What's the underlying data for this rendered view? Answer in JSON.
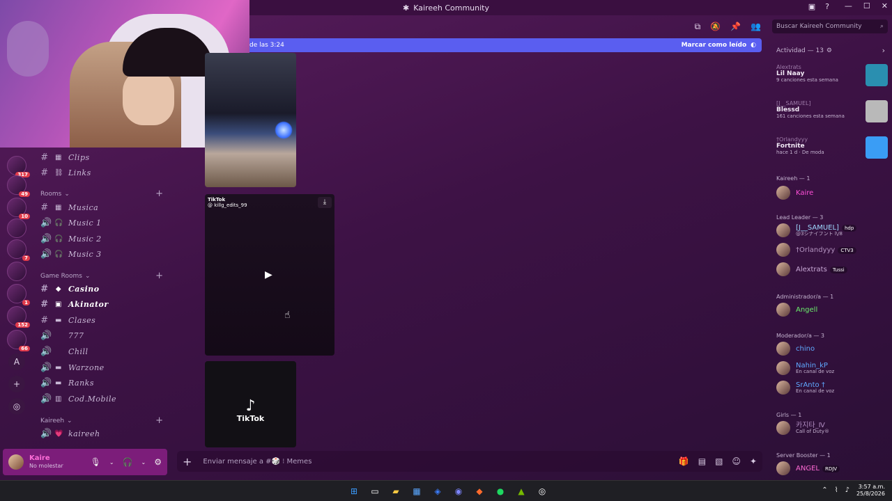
{
  "window": {
    "title": "Kaireeh Community",
    "min": "—",
    "max": "☐",
    "close": "✕"
  },
  "titlebar_icons": {
    "inbox": "▣",
    "help": "?"
  },
  "chat_header": {
    "icons": [
      "threads-icon",
      "mute-icon",
      "pin-icon",
      "members-icon"
    ],
    "search_placeholder": "Buscar Kaireeh Community"
  },
  "new_messages_bar": {
    "since": "de las 3:24",
    "mark_read": "Marcar como leído"
  },
  "servers": [
    {
      "badge": "317"
    },
    {
      "badge": "49"
    },
    {
      "badge": "10"
    },
    {
      "badge": ""
    },
    {
      "badge": "7"
    },
    {
      "badge": ""
    },
    {
      "badge": "1"
    },
    {
      "badge": "152"
    },
    {
      "badge": "66"
    }
  ],
  "rail_buttons": {
    "a_label": "A",
    "add": "+",
    "explore": "◎"
  },
  "channels": {
    "top": [
      {
        "label": "Clips",
        "emoji": "▦"
      },
      {
        "label": "Links",
        "emoji": "⛓"
      }
    ],
    "rooms_category": "Rooms",
    "rooms": [
      {
        "label": "Musica",
        "type": "text",
        "emoji": "▦"
      },
      {
        "label": "Music 1",
        "type": "voice",
        "emoji": "🎧"
      },
      {
        "label": "Music 2",
        "type": "voice",
        "emoji": "🎧"
      },
      {
        "label": "Music 3",
        "type": "voice",
        "emoji": "🎧"
      }
    ],
    "game_category": "Game Rooms",
    "games": [
      {
        "label": "Casino",
        "type": "text",
        "emoji": "◆"
      },
      {
        "label": "Akinator",
        "type": "text",
        "emoji": "▣"
      },
      {
        "label": "Clases",
        "type": "text",
        "emoji": "▬"
      },
      {
        "label": "777",
        "type": "voice",
        "emoji": ""
      },
      {
        "label": "Chill",
        "type": "voice",
        "emoji": ""
      },
      {
        "label": "Warzone",
        "type": "voice",
        "emoji": "▬"
      },
      {
        "label": "Ranks",
        "type": "voice",
        "emoji": "▬"
      },
      {
        "label": "Cod.Mobile",
        "type": "voice",
        "emoji": "▥"
      }
    ],
    "kaireeh_category": "Kaireeh",
    "kaireeh": [
      {
        "label": "kaireeh",
        "type": "voice",
        "emoji": "💗"
      }
    ]
  },
  "user": {
    "name": "Kaire",
    "status": "No molestar"
  },
  "tiktok": {
    "brand": "TikTok",
    "handle": "@ killg_edits_99"
  },
  "composer": {
    "placeholder": "Enviar mensaje a #🎲 ⁝ Memes"
  },
  "members": {
    "activity_title": "Actividad — 13",
    "activities": [
      {
        "who": "Alextrats",
        "what": "Lil Naay",
        "sub": "9 canciones esta semana",
        "thumb_color": "#2a8fb0"
      },
      {
        "who": "[J__SAMUEL]",
        "what": "Blessd",
        "sub": "161 canciones esta semana",
        "thumb_color": "#b9b9b9"
      },
      {
        "who": "†Orlandyyy",
        "what": "Fortnite",
        "sub": "hace 1 d · De moda",
        "thumb_color": "#3a9df5"
      }
    ],
    "groups": [
      {
        "title": "Kaireeh — 1",
        "members": [
          {
            "name": "Kaire",
            "color": "#ff4fd8",
            "tag": "",
            "status": ""
          }
        ]
      },
      {
        "title": "Lead Leader — 3",
        "members": [
          {
            "name": "[J__SAMUEL]",
            "color": "#9fd9ff",
            "tag": "hdp",
            "status": "@3シナイフント l\\/8"
          },
          {
            "name": "†Orlandyyy",
            "color": "#b494c0",
            "tag": "CTV3",
            "status": ""
          },
          {
            "name": "Alextrats",
            "color": "#c9a9d6",
            "tag": "Tussi",
            "status": ""
          }
        ]
      },
      {
        "title": "Administrador/a — 1",
        "members": [
          {
            "name": "Angell",
            "color": "#6cf06c",
            "tag": "",
            "status": ""
          }
        ]
      },
      {
        "title": "Moderador/a — 3",
        "members": [
          {
            "name": "chino",
            "color": "#5fa9ff",
            "tag": "",
            "status": ""
          },
          {
            "name": "Nahin_kP",
            "color": "#5fa9ff",
            "tag": "",
            "status": "En canal de voz"
          },
          {
            "name": "SrAnto †",
            "color": "#5fa9ff",
            "tag": "",
            "status": "En canal de voz"
          }
        ]
      },
      {
        "title": "Girls — 1",
        "members": [
          {
            "name": "카지타_Ⅳ",
            "color": "#b08cc0",
            "tag": "",
            "status": "Call of Duty®"
          }
        ]
      },
      {
        "title": "Server Booster — 1",
        "members": [
          {
            "name": "ANGEL",
            "color": "#ff6ad5",
            "tag": "RDJV",
            "status": ""
          }
        ]
      }
    ]
  },
  "taskbar": {
    "time": "3:57 a.m.",
    "date": "25/8/2026"
  },
  "colors": {
    "accent": "#5a5ef0",
    "userbar": "#7c1d7a",
    "bg": "#3d1245"
  }
}
